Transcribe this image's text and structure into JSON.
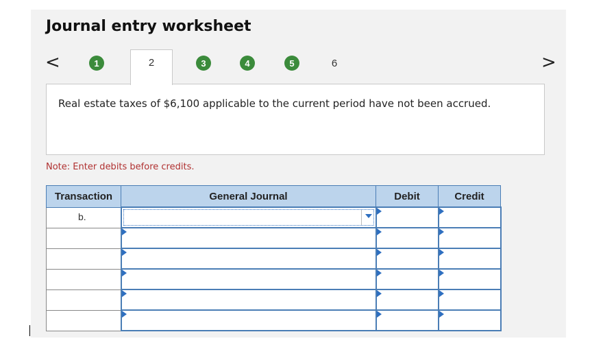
{
  "worksheet": {
    "title": "Journal entry worksheet",
    "nav_prev": "<",
    "nav_next": ">",
    "steps": [
      "1",
      "2",
      "3",
      "4",
      "5",
      "6"
    ],
    "active_step": "2",
    "description": "Real estate taxes of $6,100 applicable to the current period have not been accrued.",
    "note": "Note: Enter debits before credits.",
    "colors": {
      "step_complete": "#3b8b3b",
      "header_bg": "#bcd4ec",
      "input_border": "#4a7db5",
      "note": "#b03030"
    }
  },
  "table": {
    "headers": {
      "transaction": "Transaction",
      "general_journal": "General Journal",
      "debit": "Debit",
      "credit": "Credit"
    },
    "rows": [
      {
        "transaction": "b.",
        "general_journal": "",
        "debit": "",
        "credit": ""
      },
      {
        "transaction": "",
        "general_journal": "",
        "debit": "",
        "credit": ""
      },
      {
        "transaction": "",
        "general_journal": "",
        "debit": "",
        "credit": ""
      },
      {
        "transaction": "",
        "general_journal": "",
        "debit": "",
        "credit": ""
      },
      {
        "transaction": "",
        "general_journal": "",
        "debit": "",
        "credit": ""
      },
      {
        "transaction": "",
        "general_journal": "",
        "debit": "",
        "credit": ""
      }
    ]
  }
}
